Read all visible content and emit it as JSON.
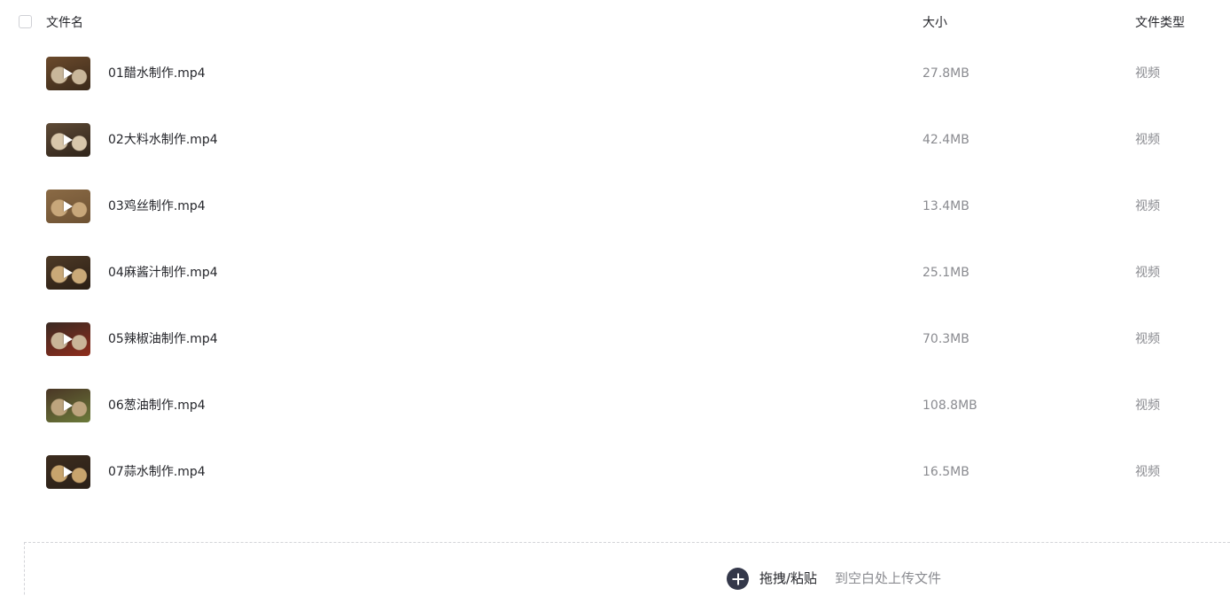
{
  "header": {
    "name_label": "文件名",
    "size_label": "大小",
    "type_label": "文件类型"
  },
  "files": [
    {
      "name": "01醋水制作.mp4",
      "size": "27.8MB",
      "type": "视频",
      "thumb_colors": [
        "#6b4a2c",
        "#c9b79a",
        "#3a2a1a"
      ]
    },
    {
      "name": "02大料水制作.mp4",
      "size": "42.4MB",
      "type": "视频",
      "thumb_colors": [
        "#5e4a36",
        "#d8c7ab",
        "#2f241a"
      ]
    },
    {
      "name": "03鸡丝制作.mp4",
      "size": "13.4MB",
      "type": "视频",
      "thumb_colors": [
        "#8a6a45",
        "#c8a77a",
        "#6e5233"
      ]
    },
    {
      "name": "04麻酱汁制作.mp4",
      "size": "25.1MB",
      "type": "视频",
      "thumb_colors": [
        "#4e3a27",
        "#caa978",
        "#2a1e14"
      ]
    },
    {
      "name": "05辣椒油制作.mp4",
      "size": "70.3MB",
      "type": "视频",
      "thumb_colors": [
        "#3a2a22",
        "#c9b598",
        "#8e2c1c"
      ]
    },
    {
      "name": "06葱油制作.mp4",
      "size": "108.8MB",
      "type": "视频",
      "thumb_colors": [
        "#4a3625",
        "#bda47e",
        "#6b7a3a"
      ]
    },
    {
      "name": "07蒜水制作.mp4",
      "size": "16.5MB",
      "type": "视频",
      "thumb_colors": [
        "#3c2c1e",
        "#c8a46d",
        "#2a2018"
      ]
    }
  ],
  "dropzone": {
    "label": "拖拽/粘贴",
    "hint": "到空白处上传文件"
  }
}
